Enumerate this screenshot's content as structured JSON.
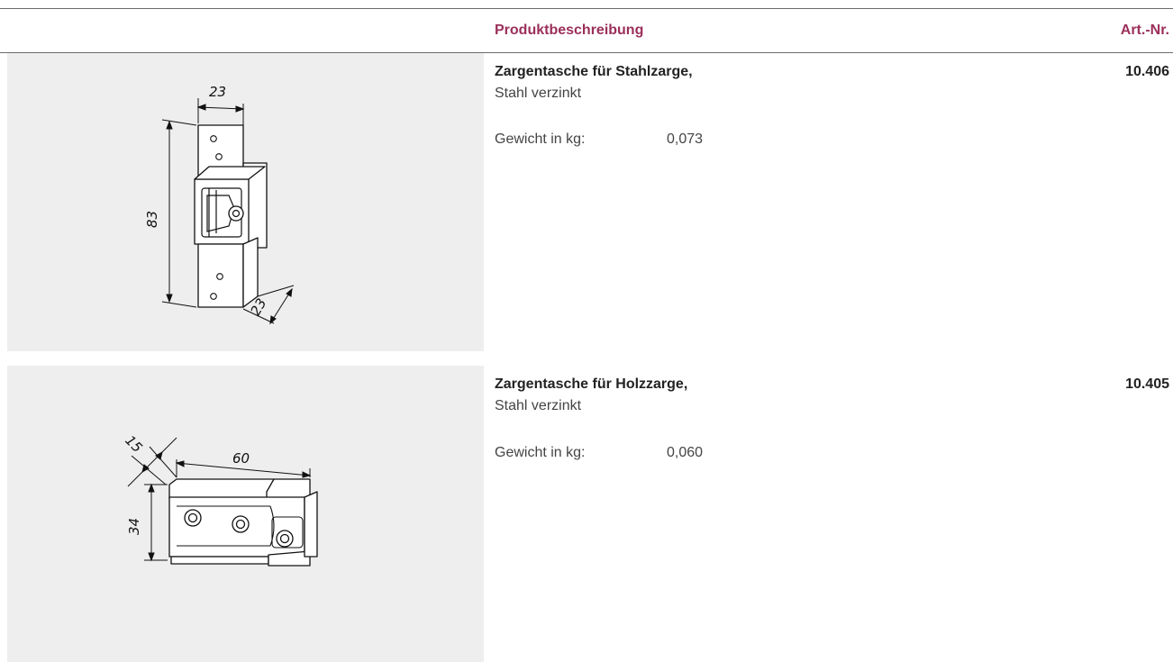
{
  "header": {
    "description_label": "Produktbeschreibung",
    "article_label": "Art.-Nr."
  },
  "products": [
    {
      "title": "Zargentasche für Stahlzarge,",
      "subtitle": "Stahl verzinkt",
      "weight_label": "Gewicht in kg:",
      "weight_value": "0,073",
      "article_number": "10.406",
      "drawing": {
        "icon": "steel-frame-pocket-drawing-icon",
        "dims": [
          "23",
          "83",
          "23"
        ]
      }
    },
    {
      "title": "Zargentasche für Holzzarge,",
      "subtitle": "Stahl verzinkt",
      "weight_label": "Gewicht in kg:",
      "weight_value": "0,060",
      "article_number": "10.405",
      "drawing": {
        "icon": "wood-frame-pocket-drawing-icon",
        "dims": [
          "15",
          "60",
          "34"
        ]
      }
    }
  ],
  "colors": {
    "accent": "#9b2f5a",
    "panel": "#eeeeee"
  }
}
